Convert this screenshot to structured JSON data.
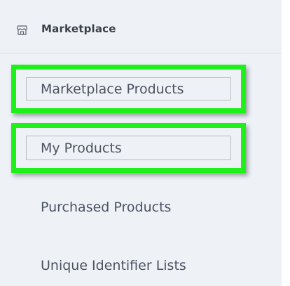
{
  "sidebar": {
    "section_title": "Marketplace",
    "section_icon": "storefront-icon",
    "items": [
      {
        "label": "Marketplace Products",
        "highlighted": true
      },
      {
        "label": "My Products",
        "highlighted": true
      },
      {
        "label": "Purchased Products",
        "highlighted": false
      },
      {
        "label": "Unique Identifier Lists",
        "highlighted": false
      }
    ]
  },
  "colors": {
    "panel_bg": "#eef2f7",
    "highlight": "#1ff01a",
    "text": "#4b5260",
    "header_text": "#3a3f4a"
  }
}
